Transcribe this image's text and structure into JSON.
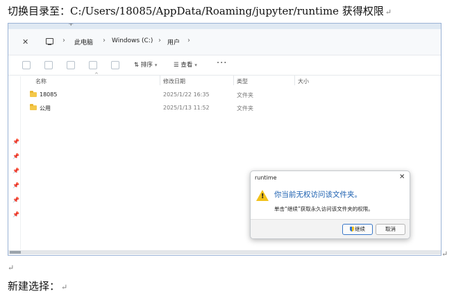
{
  "document": {
    "line1": "切换目录至：C:/Users/18085/AppData/Roaming/jupyter/runtime 获得权限",
    "line2": "新建选择：",
    "paragraph_mark": "↵"
  },
  "explorer": {
    "tab_add": "+",
    "close_label": "✕",
    "breadcrumb": [
      "此电脑",
      "Windows (C:)",
      "用户"
    ],
    "breadcrumb_sep": "›",
    "toolbar": {
      "sort": "排序",
      "view": "查看",
      "more": "···"
    },
    "columns": {
      "name": "名称",
      "modified": "修改日期",
      "type": "类型",
      "size": "大小"
    },
    "rows": [
      {
        "name": "18085",
        "modified": "2025/1/22 16:35",
        "type": "文件夹"
      },
      {
        "name": "公用",
        "modified": "2025/1/13 11:52",
        "type": "文件夹"
      }
    ],
    "pin_glyph": "📌"
  },
  "dialog": {
    "title": "runtime",
    "close": "✕",
    "message": "你当前无权访问该文件夹。",
    "detail": "单击“继续”获取永久访问该文件夹的权限。",
    "continue": "继续",
    "cancel": "取消",
    "warning_mark": "!"
  }
}
